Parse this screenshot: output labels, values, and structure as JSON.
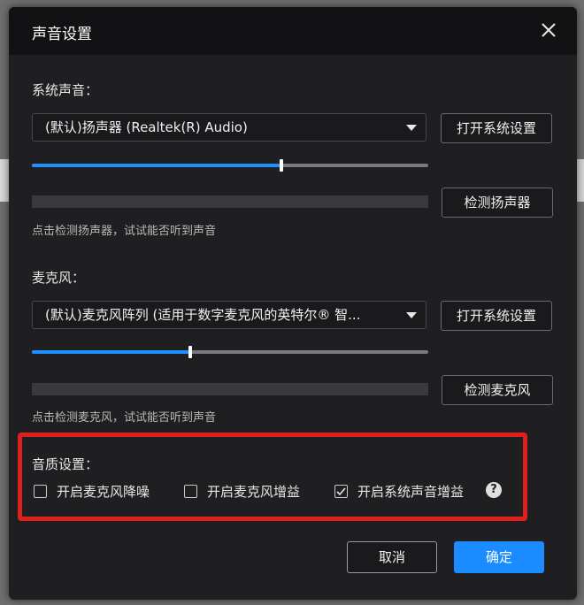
{
  "dialog": {
    "title": "声音设置",
    "close_icon": "close-icon"
  },
  "speaker": {
    "section_label": "系统声音：",
    "device": "(默认)扬声器 (Realtek(R) Audio)",
    "open_settings_label": "打开系统设置",
    "volume_fraction": 0.63,
    "test_button_label": "检测扬声器",
    "hint": "点击检测扬声器，试试能否听到声音"
  },
  "microphone": {
    "section_label": "麦克风：",
    "device": "(默认)麦克风阵列 (适用于数字麦克风的英特尔® 智...",
    "open_settings_label": "打开系统设置",
    "volume_fraction": 0.4,
    "test_button_label": "检测麦克风",
    "hint": "点击检测麦克风，试试能否听到声音"
  },
  "quality": {
    "section_label": "音质设置：",
    "options": [
      {
        "label": "开启麦克风降噪",
        "checked": false
      },
      {
        "label": "开启麦克风增益",
        "checked": false
      },
      {
        "label": "开启系统声音增益",
        "checked": true
      }
    ],
    "help_icon": "question-circle-icon",
    "help_glyph": "?"
  },
  "footer": {
    "cancel_label": "取消",
    "ok_label": "确定"
  },
  "colors": {
    "accent": "#1a8cff",
    "highlight_border": "#e0201c"
  }
}
